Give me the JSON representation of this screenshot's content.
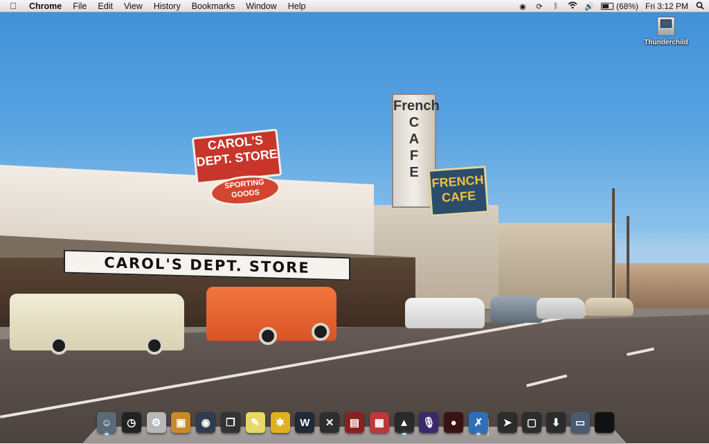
{
  "menubar": {
    "apple_icon": "apple-icon",
    "app_name": "Chrome",
    "menus": [
      "File",
      "Edit",
      "View",
      "History",
      "Bookmarks",
      "Window",
      "Help"
    ],
    "status": {
      "icons": [
        "spotlight-eye-icon",
        "sync-icon",
        "bluetooth-icon",
        "wifi-icon",
        "volume-icon",
        "battery-icon"
      ],
      "battery_percent": "(68%)",
      "battery_level": 0.68,
      "clock": "Fri 3:12 PM",
      "search_icon": "spotlight-search-icon"
    }
  },
  "desktop": {
    "icons": [
      {
        "label": "Thunderchild",
        "icon": "hard-drive-icon"
      }
    ]
  },
  "wallpaper": {
    "signs": {
      "carols_top": "CAROL'S\nDEPT. STORE",
      "sporting": "SPORTING\nGOODS",
      "store_front": "CAROL'S DEPT. STORE",
      "tower": "French\nC\nA\nF\nE",
      "french_cafe": "FRENCH\nCAFE"
    }
  },
  "dock": {
    "apps": [
      {
        "name": "Finder",
        "icon": "finder-icon",
        "color": "#5a6a78",
        "glyph": "☺",
        "running": true
      },
      {
        "name": "Clock",
        "icon": "clock-icon",
        "color": "#222222",
        "glyph": "◷",
        "running": false
      },
      {
        "name": "System Preferences",
        "icon": "system-preferences-icon",
        "color": "#b8b8b8",
        "glyph": "⚙",
        "running": false
      },
      {
        "name": "Photos",
        "icon": "photo-app-icon",
        "color": "#c98a2a",
        "glyph": "▣",
        "running": false
      },
      {
        "name": "Safari",
        "icon": "safari-icon",
        "color": "#2d3c4e",
        "glyph": "◉",
        "running": false
      },
      {
        "name": "Window Manager",
        "icon": "window-manager-icon",
        "color": "#333333",
        "glyph": "❐",
        "running": false
      },
      {
        "name": "Stickies",
        "icon": "stickies-icon",
        "color": "#e8d86a",
        "glyph": "✎",
        "running": false
      },
      {
        "name": "Chrome Tool",
        "icon": "asterisk-app-icon",
        "color": "#e0b020",
        "glyph": "✱",
        "running": false
      },
      {
        "name": "Word",
        "icon": "w-app-icon",
        "color": "#1f2a36",
        "glyph": "W",
        "running": false
      },
      {
        "name": "X Tools",
        "icon": "x-tools-icon",
        "color": "#2e2e2e",
        "glyph": "✕",
        "running": false
      },
      {
        "name": "Notes",
        "icon": "red-book-icon",
        "color": "#8a1f1f",
        "glyph": "▤",
        "running": false
      },
      {
        "name": "Calendar",
        "icon": "calendar-icon",
        "color": "#b83a3a",
        "glyph": "▦",
        "running": false
      },
      {
        "name": "VLC",
        "icon": "vlc-cone-icon",
        "color": "#2a2a2a",
        "glyph": "▲",
        "running": true
      },
      {
        "name": "Podcast",
        "icon": "microphone-icon",
        "color": "#3b2a6a",
        "glyph": "🎙",
        "running": false
      },
      {
        "name": "Game",
        "icon": "red-app-icon",
        "color": "#3a1212",
        "glyph": "●",
        "running": false
      },
      {
        "name": "Xcode",
        "icon": "xcode-icon",
        "color": "#2f6fb8",
        "glyph": "✗",
        "running": true
      }
    ],
    "folders": [
      {
        "name": "Applications",
        "icon": "applications-folder-icon",
        "color": "#2c2c2c",
        "glyph": "➤"
      },
      {
        "name": "Documents",
        "icon": "documents-folder-icon",
        "color": "#2c2c2c",
        "glyph": "▢"
      },
      {
        "name": "Downloads",
        "icon": "downloads-folder-icon",
        "color": "#2c2c2c",
        "glyph": "⬇"
      },
      {
        "name": "Desktop",
        "icon": "desktop-stack-icon",
        "color": "#4a5a70",
        "glyph": "▭"
      },
      {
        "name": "Trash",
        "icon": "trash-icon",
        "color": "#111111",
        "glyph": ""
      }
    ]
  }
}
